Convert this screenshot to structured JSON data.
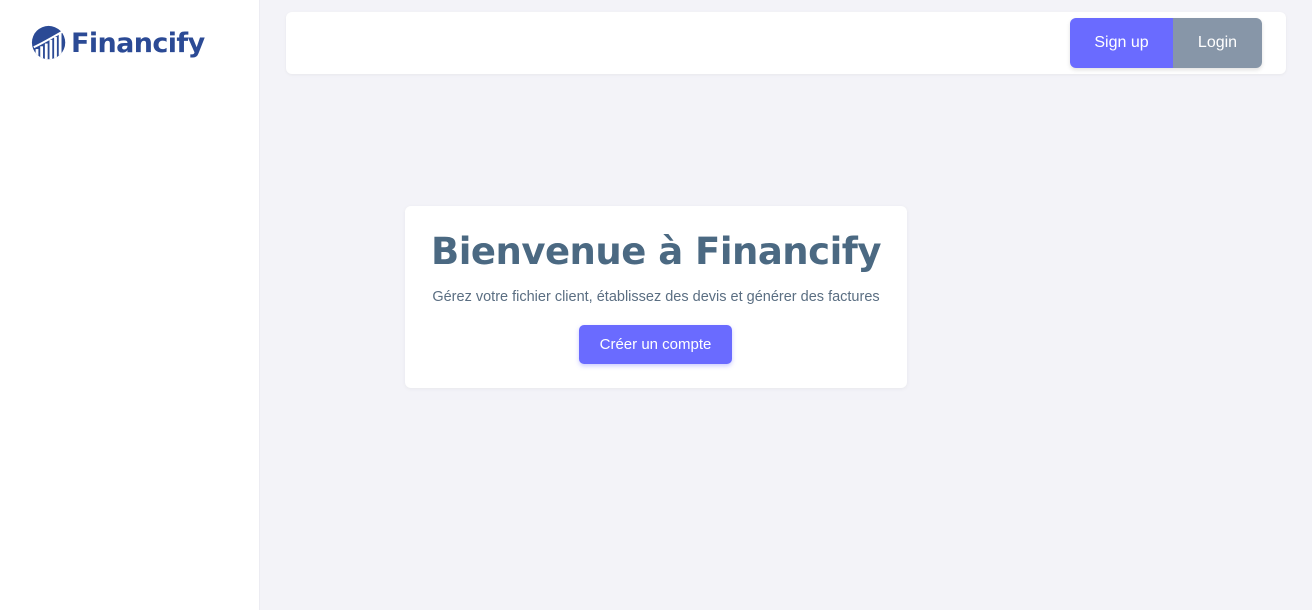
{
  "brand": {
    "name": "Financify",
    "logo_icon": "bar-chart-globe-icon",
    "color": "#2b4a95"
  },
  "header": {
    "signup_label": "Sign up",
    "login_label": "Login"
  },
  "welcome": {
    "title": "Bienvenue à Financify",
    "subtitle": "Gérez votre fichier client, établissez des devis et générer des factures",
    "cta_label": "Créer un compte"
  },
  "colors": {
    "primary": "#6a6bff",
    "secondary": "#8796a8",
    "background": "#f3f3f8",
    "title": "#4b6982"
  }
}
